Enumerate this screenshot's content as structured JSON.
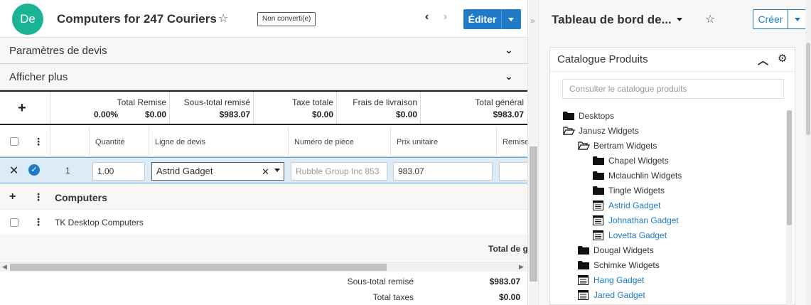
{
  "record": {
    "avatar_initials": "De",
    "title": "Computers for 247 Couriers",
    "status_badge": "Non converti(e)",
    "edit_label": "Éditer"
  },
  "sections": {
    "quote_params": "Paramètres de devis",
    "show_more": "Afficher plus"
  },
  "totals": [
    {
      "caption": "Total Remise",
      "value_pct": "0.00%",
      "value": "$0.00"
    },
    {
      "caption": "Sous-total remisé",
      "value": "$983.07"
    },
    {
      "caption": "Taxe totale",
      "value": "$0.00"
    },
    {
      "caption": "Frais de livraison",
      "value": "$0.00"
    },
    {
      "caption": "Total général",
      "value": "$983.07"
    }
  ],
  "grid": {
    "columns": [
      "Quantité",
      "Ligne de devis",
      "Numéro de pièce",
      "Prix unitaire",
      "Remise"
    ],
    "edit_row": {
      "row_number": "1",
      "quantity": "1.00",
      "line_item": "Astrid Gadget",
      "part_number": "Rubble Group Inc 853",
      "unit_price": "983.07"
    },
    "group_title": "Computers",
    "item_row_text": "TK Desktop Computers",
    "grand_total_label": "Total de g"
  },
  "summary": [
    {
      "label": "Sous-total remisé",
      "value": "$983.07"
    },
    {
      "label": "Total taxes",
      "value": "$0.00"
    }
  ],
  "dashboard": {
    "title": "Tableau de bord de...",
    "create_label": "Créer"
  },
  "catalog": {
    "title": "Catalogue Produits",
    "search_placeholder": "Consulter le catalogue produits",
    "tree": [
      {
        "label": "Desktops",
        "type": "folder",
        "depth": 0
      },
      {
        "label": "Janusz Widgets",
        "type": "folder-open",
        "depth": 0
      },
      {
        "label": "Bertram Widgets",
        "type": "folder-open",
        "depth": 1
      },
      {
        "label": "Chapel Widgets",
        "type": "folder",
        "depth": 2
      },
      {
        "label": "Mclauchlin Widgets",
        "type": "folder",
        "depth": 2
      },
      {
        "label": "Tingle Widgets",
        "type": "folder",
        "depth": 2
      },
      {
        "label": "Astrid Gadget",
        "type": "product",
        "depth": 2
      },
      {
        "label": "Johnathan Gadget",
        "type": "product",
        "depth": 2
      },
      {
        "label": "Lovetta Gadget",
        "type": "product",
        "depth": 2
      },
      {
        "label": "Dougal Widgets",
        "type": "folder",
        "depth": 1
      },
      {
        "label": "Schimke Widgets",
        "type": "folder",
        "depth": 1
      },
      {
        "label": "Hang Gadget",
        "type": "product",
        "depth": 1
      },
      {
        "label": "Jared Gadget",
        "type": "product",
        "depth": 1
      }
    ]
  },
  "colors": {
    "accent": "#1f7bc8",
    "avatar": "#1ab394",
    "selected_row": "#dcebf8"
  }
}
